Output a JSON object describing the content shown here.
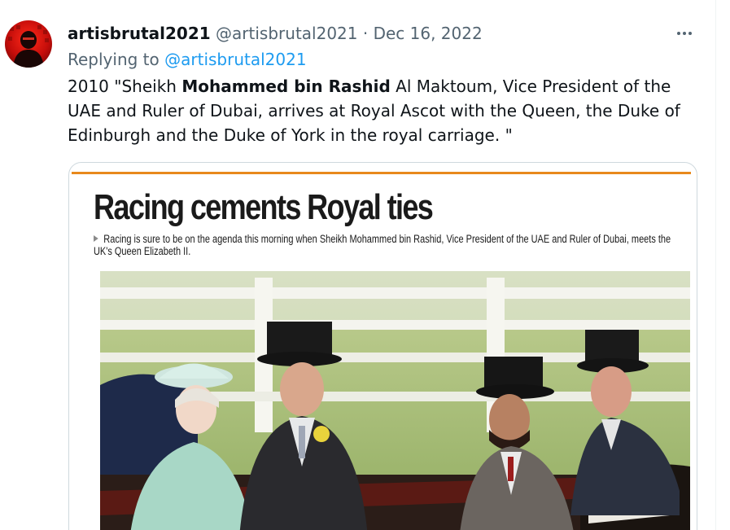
{
  "tweet": {
    "display_name": "artisbrutal2021",
    "handle": "@artisbrutal2021",
    "separator": "·",
    "date": "Dec 16, 2022",
    "replying_prefix": "Replying to",
    "replying_handle": "@artisbrutal2021",
    "text_before_bold": "2010 \"Sheikh ",
    "text_bold": "Mohammed bin Rashid",
    "text_after_bold": " Al Maktoum, Vice President of the UAE and Ruler of Dubai, arrives at Royal Ascot with the Queen, the Duke of Edinburgh and the Duke of York in the royal carriage. \"",
    "more_icon": "more-horizontal-icon"
  },
  "media": {
    "headline": "Racing cements Royal ties",
    "caption": "Racing is sure to be on the agenda this morning when Sheikh Mohammed bin Rashid, Vice President of the UAE and Ruler of Dubai, meets the UK's Queen Elizabeth II.",
    "accent_color": "#e8891c"
  },
  "colors": {
    "link": "#1d9bf0",
    "secondary_text": "#536471",
    "primary_text": "#0f1419",
    "border": "#cfd9de"
  }
}
